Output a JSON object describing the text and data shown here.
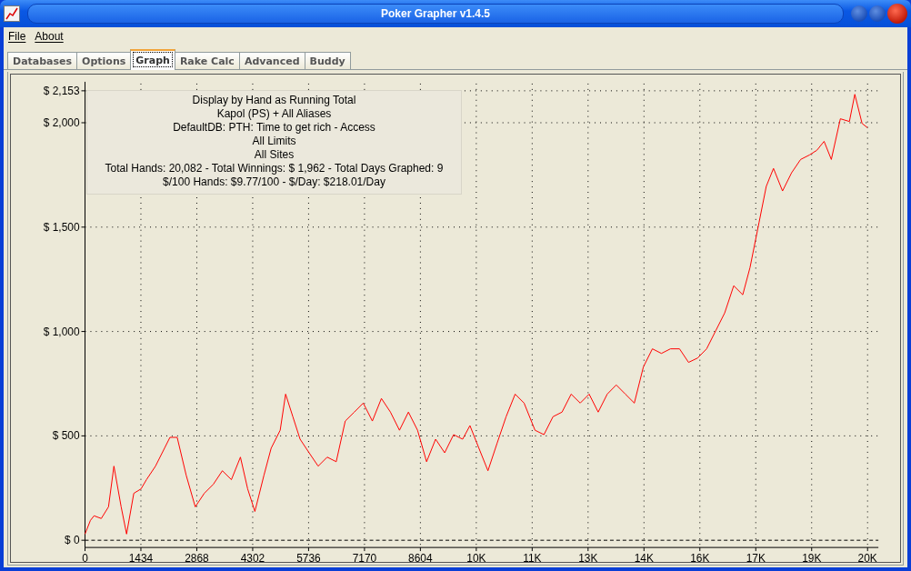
{
  "window": {
    "title": "Poker Grapher v1.4.5"
  },
  "menu": [
    {
      "label": "File"
    },
    {
      "label": "About"
    }
  ],
  "tabs": [
    {
      "label": "Databases",
      "selected": false
    },
    {
      "label": "Options",
      "selected": false
    },
    {
      "label": "Graph",
      "selected": true
    },
    {
      "label": "Rake Calc",
      "selected": false
    },
    {
      "label": "Advanced",
      "selected": false
    },
    {
      "label": "Buddy",
      "selected": false
    }
  ],
  "graph": {
    "summary_lines": [
      "Display by Hand as Running Total",
      "Kapol (PS) + All Aliases",
      "DefaultDB: PTH: Time to get rich - Access",
      "All Limits",
      "All Sites",
      "Total Hands: 20,082 - Total Winnings: $ 1,962 - Total Days Graphed: 9",
      "$/100 Hands: $9.77/100 - $/Day: $218.01/Day"
    ],
    "chart_data": {
      "type": "line",
      "grid": true,
      "xlim": [
        0,
        20076
      ],
      "ylim": [
        0,
        2153
      ],
      "xticks": [
        0,
        1434,
        2868,
        4302,
        5736,
        7170,
        8604,
        {
          "value": 10038,
          "label": "10K"
        },
        {
          "value": 11472,
          "label": "11K"
        },
        {
          "value": 12906,
          "label": "13K"
        },
        {
          "value": 14340,
          "label": "14K"
        },
        {
          "value": 15774,
          "label": "16K"
        },
        {
          "value": 17208,
          "label": "17K"
        },
        {
          "value": 18642,
          "label": "19K"
        },
        {
          "value": 20076,
          "label": "20K"
        }
      ],
      "yticks": [
        {
          "value": 0,
          "label": "$ 0"
        },
        {
          "value": 500,
          "label": "$ 500"
        },
        {
          "value": 1000,
          "label": "$ 1,000"
        },
        {
          "value": 1500,
          "label": "$ 1,500"
        },
        {
          "value": 2000,
          "label": "$ 2,000"
        },
        {
          "value": 2153,
          "label": "$ 2,153"
        }
      ],
      "x": [
        0,
        139,
        232,
        417,
        603,
        742,
        927,
        1066,
        1252,
        1437,
        1576,
        1808,
        2040,
        2179,
        2364,
        2596,
        2828,
        3060,
        3292,
        3523,
        3755,
        3987,
        4172,
        4358,
        4590,
        4775,
        5007,
        5146,
        5331,
        5517,
        5749,
        5980,
        6212,
        6444,
        6676,
        6908,
        7139,
        7371,
        7603,
        7835,
        8067,
        8298,
        8530,
        8762,
        8994,
        9226,
        9457,
        9689,
        9875,
        10106,
        10338,
        10570,
        10802,
        11034,
        11265,
        11544,
        11775,
        12007,
        12239,
        12471,
        12703,
        12934,
        13166,
        13398,
        13630,
        13862,
        14093,
        14325,
        14557,
        14789,
        15021,
        15252,
        15484,
        15716,
        15948,
        16180,
        16411,
        16643,
        16875,
        17060,
        17292,
        17478,
        17663,
        17895,
        18127,
        18359,
        18590,
        18776,
        18961,
        19147,
        19379,
        19611,
        19750,
        19935,
        20074
      ],
      "series": [
        {
          "color": "#ff0000",
          "values": [
            30,
            95,
            117,
            104,
            160,
            355,
            160,
            30,
            225,
            246,
            290,
            355,
            441,
            493,
            493,
            311,
            160,
            225,
            268,
            333,
            290,
            398,
            246,
            138,
            311,
            441,
            527,
            700,
            592,
            484,
            419,
            355,
            398,
            376,
            571,
            614,
            657,
            571,
            679,
            614,
            527,
            614,
            527,
            376,
            484,
            419,
            506,
            484,
            549,
            441,
            333,
            463,
            592,
            700,
            657,
            527,
            506,
            592,
            614,
            700,
            657,
            700,
            614,
            700,
            744,
            700,
            657,
            830,
            917,
            895,
            917,
            917,
            852,
            873,
            917,
            1003,
            1089,
            1219,
            1176,
            1306,
            1522,
            1695,
            1781,
            1673,
            1760,
            1824,
            1846,
            1868,
            1911,
            1824,
            2019,
            2006,
            2136,
            1997,
            1976
          ]
        }
      ]
    }
  }
}
